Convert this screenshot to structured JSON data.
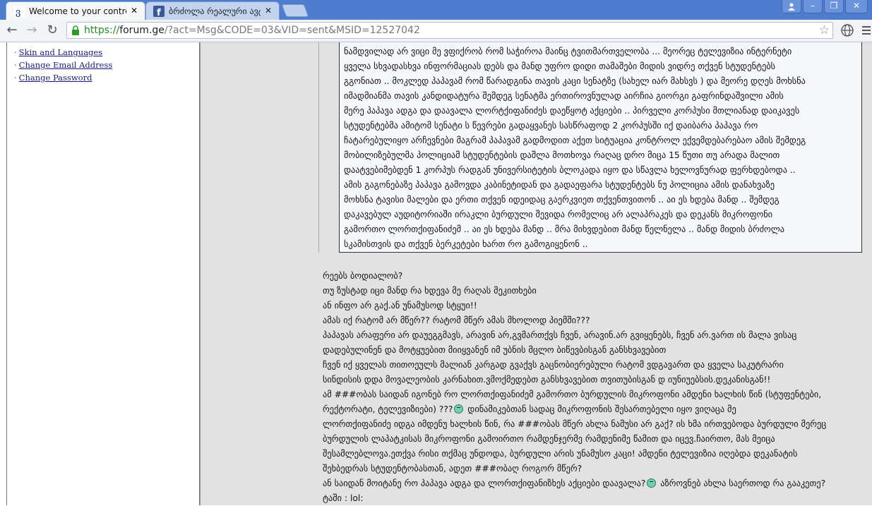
{
  "browser": {
    "tabs": [
      {
        "title": "Welcome to your control p",
        "active": true,
        "icon": "forum-ge-favicon"
      },
      {
        "title": "ბრძოლა რეალური ავტო",
        "active": false,
        "icon": "facebook-favicon"
      }
    ],
    "url": {
      "scheme": "https://",
      "host": "forum.ge",
      "path": "/?act=Msg&CODE=03&VID=sent&MSID=12527042"
    }
  },
  "sidebar": {
    "links": [
      {
        "label": "Skin and Languages"
      },
      {
        "label": "Change Email Address"
      },
      {
        "label": "Change Password"
      }
    ]
  },
  "message": {
    "quote_lines": [
      "ნამდვილად არ ვიცი მე ვფიქრობ რომ საჭიროა მაინც ტვითმართველობა ... მეორეც ტელევიზია ინტერნეტი",
      "ყველა სხვადასხვა ინფორმაციას დებს და მანდ უფრო დიდი თამაშები მიდის ვიდრე თქვენ სტუდენტებს",
      "გგონიათ .. მოკლედ პაპავამ რომ წარადგინა თავის კაცი სენატზე (სახელ იარ მახსვს ) და მეორე დღეს მოხსნა",
      "იმადმიანმა თავის კანდიდატურა შემდეგ სენატმა ერთიროვნულად აირჩია გიორგი გაფრინდაშვილი ამის",
      "მერე პაპავა ადგა და დაავალა ლორტქიფანიძეს დაეწყოტ აქციები .. პირველი კორპუსი მთლიანად დაიკავეს",
      "სტუდენტებმა ამიტომ სენატი ს წევრები გადაყვანეს სასწრაფოდ 2 კორპუსში იქ დაიბარა პაპავა რო",
      "ჩატარებულიყო არჩევნები მაგრამ პაპავამ გადმოდით აქეთ სიტუაცია კონტროლ ექვემდებარებაო ამის შემდეგ",
      "მობილიზებულმა პოლიციამ სტუდენტების დაშლა მოთხოვა რაღაც დრო მიცა 15 წუთი თუ არადა მალით",
      "დაატვებიმებდენ 1 კორპუს რადგან უნივერსიტეტის ბლოკადა იყო და სწავლა ხელოვნურად ფერხდებოდა ..",
      "ამის გაგონებაზე პაპავა გამოვდა კაბინეტიდან და გადაეფარა სტუდენტებს ნუ პოლიცია ამის დანახვაზე",
      "მოხსნა ტავისი მალები და ერთი თქვენ იდეიდაც გაერკვიეთ თქვენთვითონ .. აი ეს ხდება მანდ .. შემდეგ",
      "დაკავებულ აუდიტორიაში ირაკლი ბურდული შევიდა რომელიც არ ალაპრაკეს და დეკანს მიკროფონი",
      "გამორთო ლორთქიფანიძემ .. აი ეს ხდება მანდ .. მრა მიხვდებით მანდ წელნელა .. მანდ მიდის ბრძოლა",
      "სკამისთვის და თქვენ ბერკეტები ხართ რო გამოგიყენონ .."
    ],
    "body_lines": [
      "რეებს ბოდიალობ?",
      "თუ ზუსტად იცი მანდ რა ხდევა მე რაღას მეკითხები",
      "ან ინფო არ გაქ.ან უნამუსოდ სტყუი!!",
      "ამას იქ რატომ არ მწერ?? რატომ მწერ ამას მხოლოდ პიემში???",
      "პაპავას არაფერი არ დაუეგგმავს, არავინ არ,გვმართქვს ჩვენ, არავინ.არ გვიყენებს, ჩვენ არ.ვართ ის მალა ვისაც",
      "დადებულინენ და მოტყუებით მიიყვანენ იმ უბნის მცლო ბიწევბისგან განსხვავებით",
      "ჩვენ იქ ყველას თითოეულს მალიან კარგად გვაქვს გაცნობიერებული რატომ ვდგავართ და ყველა საკუტრარი",
      "სინდისის დდა მოვალეობის კარნახით.ვმოქმედებთ განსხვავებით თვითუბისგან დ იუნიუებსის.დეკანისგან!!",
      "ამ ###ობას საიდან იგონებ რო ლორთქიფანიძემ გამორთო ბურდულის მიკროფონი ამდენი ხალხის წინ (სტუფენტები,",
      "რექტორატი, ტელევიზიები) ???|SMILEY| დინამიკებთან სადაც მიკროფონის შესართებელი იყო ვიღაცა მე",
      "ლორთქიფანიძე იდგა იმდენუ ხალხის წინ, რა ###ობას მწერ ახლა ნამუსი არ გაქ? ის ხმა ირთვებოდა ბურდული მერეც",
      "ბურდულის ლაპატკისას მიკროფონი გამოირთო რამდენჯერმე რამდენიმე წამით და იცევ.ჩაირთო, მას მეიცა",
      "შესამლებლოვა.ეთქვა რისი თქმაც უნდოდა, ბურდული არის უნამუსო კაცი! ამდენი ტელევიზია იღებდა დეკანატის",
      "შეხბედრას სტუდენტობასთან, ადეთ ###ობაღ როგორ მწერ?",
      "ან საიდან მოიტანე რო პაპავა ადგა და ლორთქიფანიზხეს აქციები დაავალა?|SMILEY| აზროვნებ ახლა საერთოდ რა გააკეთე?",
      "ტაში : lol:"
    ]
  }
}
